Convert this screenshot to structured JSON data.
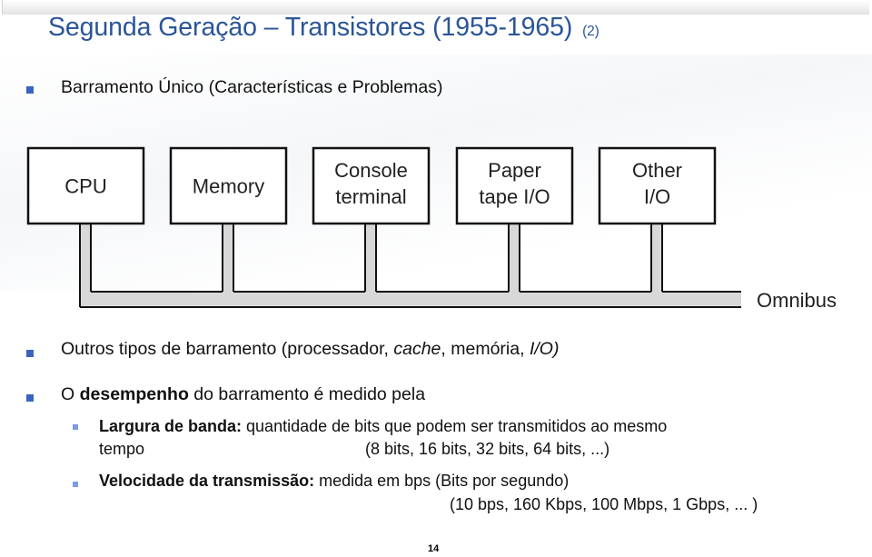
{
  "slide": {
    "title": "Segunda Geração – Transistores (1955-1965)",
    "title_suffix": "(2)",
    "page_number": "14",
    "colors": {
      "title": "#2a5597",
      "bullet_primary": "#3b64c0",
      "bullet_secondary": "#7d9be0",
      "bus_fill": "#d8d8d8"
    }
  },
  "bullets": [
    {
      "text": "Barramento Único (Características e Problemas)"
    },
    {
      "parts": [
        {
          "t": "Outros tipos de barramento (processador, ",
          "style": "normal"
        },
        {
          "t": "cache",
          "style": "italic"
        },
        {
          "t": ", memória, ",
          "style": "normal"
        },
        {
          "t": "I/O)",
          "style": "italic"
        }
      ]
    },
    {
      "parts": [
        {
          "t": "O ",
          "style": "normal"
        },
        {
          "t": "desempenho",
          "style": "bold"
        },
        {
          "t": " do barramento é medido pela",
          "style": "normal"
        }
      ]
    }
  ],
  "subbullets": [
    {
      "label": "Largura de banda:",
      "text": " quantidade de bits que podem ser transmitidos ao mesmo",
      "line2_left": "tempo",
      "line2_right": "(8 bits, 16 bits, 32 bits, 64 bits, ...)"
    },
    {
      "label": "Velocidade da transmissão:",
      "text": " medida em bps (Bits por segundo)",
      "line2_right": "(10 bps, 160 Kbps, 100 Mbps, 1 Gbps, ... )"
    }
  ],
  "diagram": {
    "bus_label": "Omnibus",
    "components": [
      {
        "lines": [
          "CPU"
        ]
      },
      {
        "lines": [
          "Memory"
        ]
      },
      {
        "lines": [
          "Console",
          "terminal"
        ]
      },
      {
        "lines": [
          "Paper",
          "tape I/O"
        ]
      },
      {
        "lines": [
          "Other",
          "I/O"
        ]
      }
    ]
  }
}
